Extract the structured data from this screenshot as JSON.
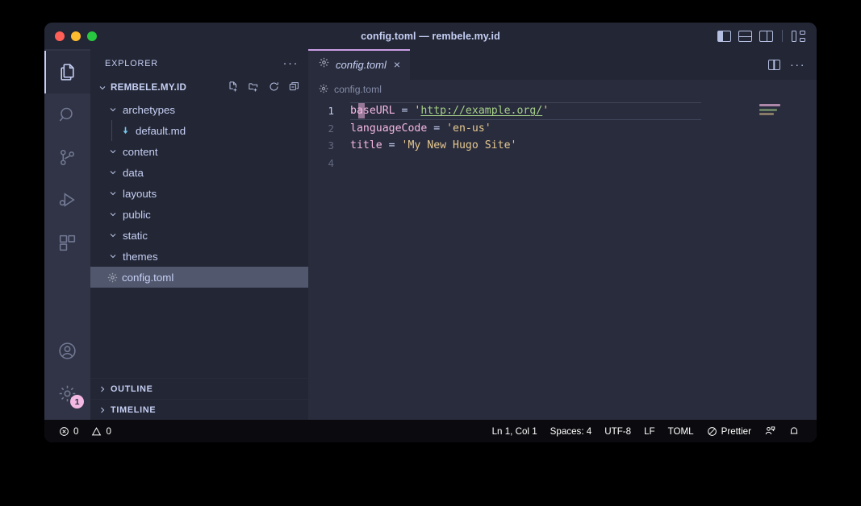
{
  "window": {
    "title": "config.toml — rembele.my.id",
    "traffic_lights": [
      "close",
      "minimize",
      "zoom"
    ],
    "layout_toggles": [
      {
        "name": "toggle-primary-sidebar",
        "icon": "primary-sidebar-icon"
      },
      {
        "name": "toggle-panel",
        "icon": "panel-icon"
      },
      {
        "name": "toggle-secondary-sidebar",
        "icon": "secondary-sidebar-icon"
      },
      {
        "name": "customize-layout",
        "icon": "customize-layout-icon"
      }
    ]
  },
  "activity_bar": {
    "items": [
      {
        "name": "explorer",
        "icon": "files-icon",
        "active": true,
        "badge": null
      },
      {
        "name": "search",
        "icon": "search-icon",
        "active": false,
        "badge": null
      },
      {
        "name": "source-control",
        "icon": "source-control-icon",
        "active": false,
        "badge": null
      },
      {
        "name": "run-and-debug",
        "icon": "run-debug-icon",
        "active": false,
        "badge": null
      },
      {
        "name": "extensions",
        "icon": "extensions-icon",
        "active": false,
        "badge": null
      },
      {
        "name": "accounts",
        "icon": "account-icon",
        "active": false,
        "badge": null
      },
      {
        "name": "manage-settings",
        "icon": "gear-icon",
        "active": false,
        "badge": "1"
      }
    ],
    "badge_color": "#f4b8e4"
  },
  "sidebar": {
    "header": "EXPLORER",
    "header_more": "···",
    "folder": {
      "name": "REMBELE.MY.ID",
      "expanded": true,
      "actions": [
        "new-file",
        "new-folder",
        "refresh-explorer",
        "collapse-folders"
      ]
    },
    "tree": [
      {
        "label": "archetypes",
        "type": "folder",
        "depth": 0,
        "expanded": true,
        "selected": false
      },
      {
        "label": "default.md",
        "type": "markdown-file",
        "depth": 1,
        "expanded": false,
        "selected": false
      },
      {
        "label": "content",
        "type": "folder",
        "depth": 0,
        "expanded": true,
        "selected": false
      },
      {
        "label": "data",
        "type": "folder",
        "depth": 0,
        "expanded": true,
        "selected": false
      },
      {
        "label": "layouts",
        "type": "folder",
        "depth": 0,
        "expanded": true,
        "selected": false
      },
      {
        "label": "public",
        "type": "folder",
        "depth": 0,
        "expanded": true,
        "selected": false
      },
      {
        "label": "static",
        "type": "folder",
        "depth": 0,
        "expanded": true,
        "selected": false
      },
      {
        "label": "themes",
        "type": "folder",
        "depth": 0,
        "expanded": true,
        "selected": false
      },
      {
        "label": "config.toml",
        "type": "config-file",
        "depth": 0,
        "expanded": false,
        "selected": true
      }
    ],
    "sections": [
      {
        "label": "OUTLINE",
        "expanded": false
      },
      {
        "label": "TIMELINE",
        "expanded": false
      }
    ]
  },
  "editor": {
    "tabs": [
      {
        "label": "config.toml",
        "icon": "gear-icon",
        "active": true,
        "preview": true,
        "close": "×"
      }
    ],
    "tab_actions": [
      "split-editor",
      "more-actions"
    ],
    "breadcrumb": {
      "icon": "gear-icon",
      "label": "config.toml"
    },
    "language": "toml",
    "lines": [
      {
        "number": "1",
        "active": true,
        "tokens": [
          {
            "text": "baseURL",
            "kind": "key"
          },
          {
            "text": " = ",
            "kind": "eq"
          },
          {
            "text": "'",
            "kind": "str"
          },
          {
            "text": "http://example.org/",
            "kind": "link"
          },
          {
            "text": "'",
            "kind": "str"
          }
        ]
      },
      {
        "number": "2",
        "active": false,
        "tokens": [
          {
            "text": "languageCode",
            "kind": "key"
          },
          {
            "text": " = ",
            "kind": "eq"
          },
          {
            "text": "'en-us'",
            "kind": "str"
          }
        ]
      },
      {
        "number": "3",
        "active": false,
        "tokens": [
          {
            "text": "title",
            "kind": "key"
          },
          {
            "text": " = ",
            "kind": "eq"
          },
          {
            "text": "'My New Hugo Site'",
            "kind": "str"
          }
        ]
      },
      {
        "number": "4",
        "active": false,
        "tokens": []
      }
    ]
  },
  "status_bar": {
    "left": [
      {
        "name": "error-count",
        "icon": "error-icon",
        "text": "0"
      },
      {
        "name": "warning-count",
        "icon": "warning-icon",
        "text": "0"
      }
    ],
    "right": [
      {
        "name": "cursor-position",
        "icon": null,
        "text": "Ln 1, Col 1"
      },
      {
        "name": "indentation",
        "icon": null,
        "text": "Spaces: 4"
      },
      {
        "name": "encoding",
        "icon": null,
        "text": "UTF-8"
      },
      {
        "name": "line-endings",
        "icon": null,
        "text": "LF"
      },
      {
        "name": "language-mode",
        "icon": null,
        "text": "TOML"
      },
      {
        "name": "prettier-formatter",
        "icon": "circle-slash-icon",
        "text": "Prettier"
      },
      {
        "name": "feedback",
        "icon": "feedback-icon",
        "text": ""
      },
      {
        "name": "notifications",
        "icon": "bell-icon",
        "text": ""
      }
    ]
  },
  "theme": {
    "editor_bg": "#292c3c",
    "sidebar_bg": "#232634",
    "activity_bg": "#303446",
    "status_bg": "#0b0b0f",
    "accent": "#ca9ee6",
    "selection": "#51576d",
    "text": "#c6d0f5",
    "key_color": "#f4b8e4",
    "string_color": "#e5c890",
    "link_color": "#a6d189"
  }
}
